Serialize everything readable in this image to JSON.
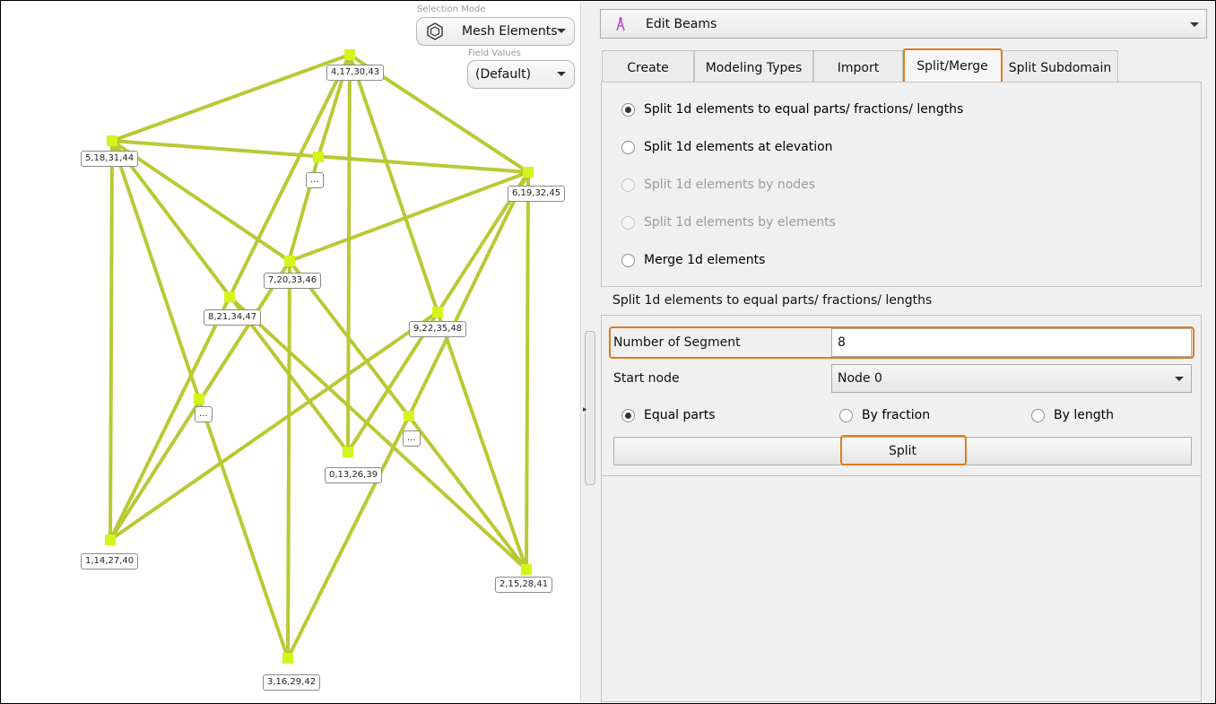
{
  "viewport": {
    "selection_mode": {
      "caption": "Selection Mode",
      "value": "Mesh Elements",
      "icon": "hexagon-icon"
    },
    "field_values": {
      "caption": "Field Values",
      "value": "(Default)"
    },
    "colors": {
      "beam": "#b9c935",
      "node": "#d4f51c"
    },
    "node_labels": [
      "4,17,30,43",
      "5,18,31,44",
      "6,19,32,45",
      "7,20,33,46",
      "8,21,34,47",
      "9,22,35,48",
      "0,13,26,39",
      "1,14,27,40",
      "2,15,28,41",
      "3,16,29,42",
      "...",
      "...",
      "..."
    ]
  },
  "panel": {
    "edit_combo": {
      "label": "Edit Beams",
      "icon": "beam-tool-icon"
    },
    "tabs": [
      {
        "label": "Create"
      },
      {
        "label": "Modeling Types"
      },
      {
        "label": "Import"
      },
      {
        "label": "Split/Merge",
        "active": true
      },
      {
        "label": "Split Subdomain"
      }
    ],
    "options": [
      {
        "label": "Split 1d elements to equal parts/ fractions/ lengths",
        "checked": true,
        "enabled": true
      },
      {
        "label": "Split 1d elements at elevation",
        "checked": false,
        "enabled": true
      },
      {
        "label": "Split 1d elements by nodes",
        "checked": false,
        "enabled": false
      },
      {
        "label": "Split 1d elements by elements",
        "checked": false,
        "enabled": false
      },
      {
        "label": "Merge 1d elements",
        "checked": false,
        "enabled": true
      }
    ],
    "section_title": "Split 1d elements to equal parts/ fractions/ lengths",
    "segment": {
      "label": "Number of Segment",
      "value": "8"
    },
    "start_node": {
      "label": "Start node",
      "value": "Node 0"
    },
    "mode": [
      {
        "label": "Equal parts",
        "checked": true
      },
      {
        "label": "By fraction",
        "checked": false
      },
      {
        "label": "By length",
        "checked": false
      }
    ],
    "split_button": "Split",
    "highlight_color": "#e07b1c"
  }
}
